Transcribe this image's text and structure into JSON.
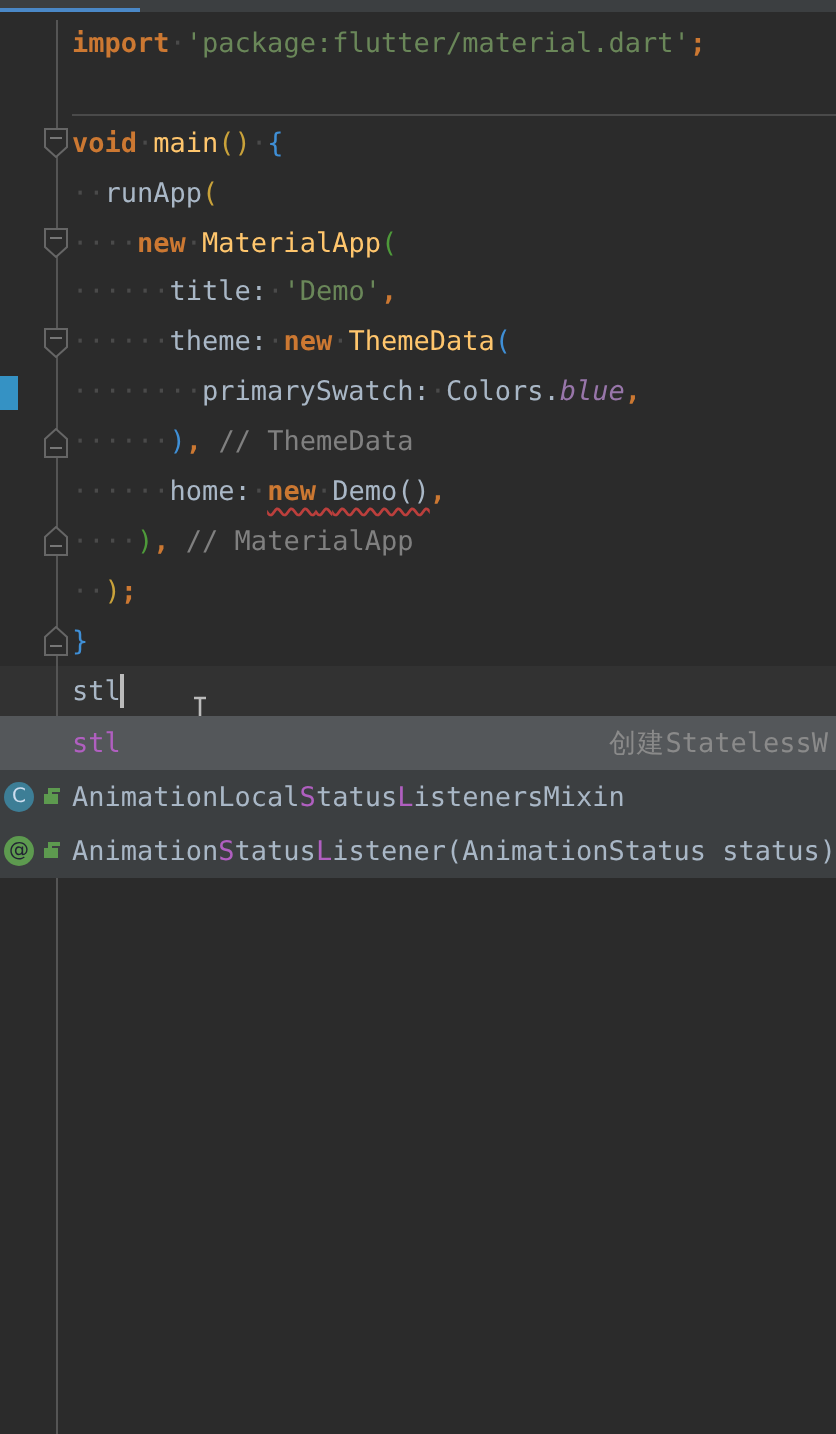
{
  "editor": {
    "lines": [
      {
        "fold_start": false,
        "fold_end": false,
        "changed": false,
        "current": false,
        "separator": false,
        "tokens": [
          {
            "kind": "keyword",
            "text": "import"
          },
          {
            "kind": "whitespace",
            "text": "·"
          },
          {
            "kind": "string",
            "text": "'package:flutter/material.dart'"
          },
          {
            "kind": "keyword",
            "text": ";"
          }
        ]
      },
      {
        "fold_start": false,
        "fold_end": false,
        "changed": false,
        "current": false,
        "separator": true
      },
      {
        "fold_start": true,
        "fold_end": false,
        "changed": false,
        "current": false,
        "separator": false,
        "tokens": [
          {
            "kind": "keyword",
            "text": "void"
          },
          {
            "kind": "whitespace",
            "text": "·"
          },
          {
            "kind": "function",
            "text": "main"
          },
          {
            "kind": "bracket",
            "color": "#c9a23a",
            "text": "()"
          },
          {
            "kind": "whitespace",
            "text": "·"
          },
          {
            "kind": "bracket",
            "color": "#3f8fd6",
            "text": "{"
          }
        ]
      },
      {
        "fold_start": false,
        "fold_end": false,
        "changed": false,
        "current": false,
        "separator": false,
        "tokens": [
          {
            "kind": "whitespace",
            "text": "··"
          },
          {
            "kind": "plain",
            "text": "runApp"
          },
          {
            "kind": "bracket",
            "color": "#c9a23a",
            "text": "("
          }
        ]
      },
      {
        "fold_start": true,
        "fold_end": false,
        "changed": false,
        "current": false,
        "separator": false,
        "tokens": [
          {
            "kind": "whitespace",
            "text": "····"
          },
          {
            "kind": "keyword",
            "text": "new"
          },
          {
            "kind": "whitespace",
            "text": "·"
          },
          {
            "kind": "function",
            "text": "MaterialApp"
          },
          {
            "kind": "bracket",
            "color": "#4e9a3a",
            "text": "("
          }
        ]
      },
      {
        "fold_start": false,
        "fold_end": false,
        "changed": false,
        "current": false,
        "separator": false,
        "tokens": [
          {
            "kind": "whitespace",
            "text": "······"
          },
          {
            "kind": "plain",
            "text": "title:"
          },
          {
            "kind": "whitespace",
            "text": "·"
          },
          {
            "kind": "string",
            "text": "'Demo'"
          },
          {
            "kind": "keyword",
            "text": ","
          }
        ]
      },
      {
        "fold_start": true,
        "fold_end": false,
        "changed": false,
        "current": false,
        "separator": false,
        "tokens": [
          {
            "kind": "whitespace",
            "text": "······"
          },
          {
            "kind": "plain",
            "text": "theme:"
          },
          {
            "kind": "whitespace",
            "text": "·"
          },
          {
            "kind": "keyword",
            "text": "new"
          },
          {
            "kind": "whitespace",
            "text": "·"
          },
          {
            "kind": "function",
            "text": "ThemeData"
          },
          {
            "kind": "bracket",
            "color": "#3f8fd6",
            "text": "("
          }
        ]
      },
      {
        "fold_start": false,
        "fold_end": false,
        "changed": true,
        "current": false,
        "separator": false,
        "tokens": [
          {
            "kind": "whitespace",
            "text": "········"
          },
          {
            "kind": "plain",
            "text": "primarySwatch:"
          },
          {
            "kind": "whitespace",
            "text": "·"
          },
          {
            "kind": "plain",
            "text": "Colors."
          },
          {
            "kind": "constant",
            "text": "blue"
          },
          {
            "kind": "keyword",
            "text": ","
          }
        ]
      },
      {
        "fold_start": false,
        "fold_end": true,
        "changed": false,
        "current": false,
        "separator": false,
        "tokens": [
          {
            "kind": "whitespace",
            "text": "······"
          },
          {
            "kind": "bracket",
            "color": "#3f8fd6",
            "text": ")"
          },
          {
            "kind": "keyword",
            "text": ","
          },
          {
            "kind": "comment",
            "text": " // ThemeData"
          }
        ]
      },
      {
        "fold_start": false,
        "fold_end": false,
        "changed": false,
        "current": false,
        "separator": false,
        "tokens": [
          {
            "kind": "whitespace",
            "text": "······"
          },
          {
            "kind": "plain",
            "text": "home:"
          },
          {
            "kind": "whitespace",
            "text": "·"
          },
          {
            "kind": "keyword",
            "text": "new",
            "error": true
          },
          {
            "kind": "whitespace",
            "text": "·",
            "error": true
          },
          {
            "kind": "plain",
            "text": "Demo()",
            "error": true
          },
          {
            "kind": "keyword",
            "text": ","
          }
        ]
      },
      {
        "fold_start": false,
        "fold_end": true,
        "changed": false,
        "current": false,
        "separator": false,
        "tokens": [
          {
            "kind": "whitespace",
            "text": "····"
          },
          {
            "kind": "bracket",
            "color": "#4e9a3a",
            "text": ")"
          },
          {
            "kind": "keyword",
            "text": ","
          },
          {
            "kind": "comment",
            "text": " // MaterialApp"
          }
        ]
      },
      {
        "fold_start": false,
        "fold_end": false,
        "changed": false,
        "current": false,
        "separator": false,
        "tokens": [
          {
            "kind": "whitespace",
            "text": "··"
          },
          {
            "kind": "bracket",
            "color": "#c9a23a",
            "text": ")"
          },
          {
            "kind": "keyword",
            "text": ";"
          }
        ]
      },
      {
        "fold_start": false,
        "fold_end": true,
        "changed": false,
        "current": false,
        "separator": false,
        "tokens": [
          {
            "kind": "bracket",
            "color": "#3f8fd6",
            "text": "}"
          }
        ]
      },
      {
        "fold_start": false,
        "fold_end": false,
        "changed": false,
        "current": true,
        "separator": false,
        "tokens": [
          {
            "kind": "plain",
            "text": "stl"
          }
        ]
      }
    ]
  },
  "completion": {
    "items": [
      {
        "kind": "template",
        "selected": true,
        "parts": [
          {
            "text": "stl",
            "match": true
          }
        ],
        "hint": "创建StatelessW"
      },
      {
        "kind": "class",
        "selected": false,
        "icon": "C",
        "parts": [
          {
            "text": "AnimationLocal",
            "match": false
          },
          {
            "text": "S",
            "match": true
          },
          {
            "text": "tatus",
            "match": false
          },
          {
            "text": "L",
            "match": true
          },
          {
            "text": "istenersMixin",
            "match": false
          }
        ]
      },
      {
        "kind": "method",
        "selected": false,
        "icon": "@",
        "parts": [
          {
            "text": "Animation",
            "match": false
          },
          {
            "text": "S",
            "match": true
          },
          {
            "text": "tatus",
            "match": false
          },
          {
            "text": "L",
            "match": true
          },
          {
            "text": "istener(AnimationStatus status)",
            "match": false
          }
        ]
      }
    ]
  }
}
